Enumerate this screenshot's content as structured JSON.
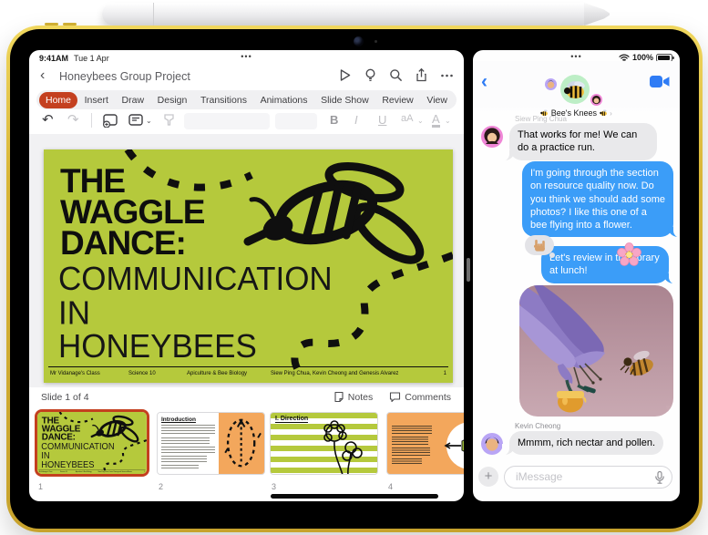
{
  "device": {
    "time": "9:41AM",
    "date": "Tue 1 Apr",
    "battery": "100%",
    "multitask_indicator": "...",
    "status_icons": [
      "wifi-icon",
      "battery-icon"
    ]
  },
  "powerpoint": {
    "document_title": "Honeybees Group Project",
    "tabs": [
      "Home",
      "Insert",
      "Draw",
      "Design",
      "Transitions",
      "Animations",
      "Slide Show",
      "Review",
      "View"
    ],
    "selected_tab": "Home",
    "nav_icons": [
      "back-chevron",
      "play-slideshow",
      "designer-lightbulb",
      "search",
      "share",
      "more-ellipsis"
    ],
    "toolbar_icons": [
      "undo",
      "redo",
      "new-slide",
      "slide-layout",
      "format-painter",
      "bold",
      "italic",
      "underline",
      "text-size",
      "font-color",
      "highlighter"
    ],
    "toolbar": {
      "bold": "B",
      "italic": "I",
      "underline": "U",
      "text_size": "aA",
      "font_color": "A"
    },
    "slide": {
      "title_bold_lines": [
        "THE",
        "WAGGLE",
        "DANCE:"
      ],
      "title_light_lines": [
        "COMMUNICATION",
        "IN",
        "HONEYBEES"
      ],
      "footer": {
        "class_name": "Mr Vidanage's Class",
        "course": "Science 10",
        "subject": "Apiculture & Bee Biology",
        "authors": "Siew Ping Chua, Kevin Cheong and Genesis Alvarez",
        "page_number": "1"
      }
    },
    "status_bar": {
      "slide_counter": "Slide 1 of 4",
      "notes_label": "Notes",
      "comments_label": "Comments"
    },
    "thumbnails": [
      {
        "number": "1",
        "selected": true
      },
      {
        "number": "2",
        "selected": false,
        "heading": "Introduction"
      },
      {
        "number": "3",
        "selected": false,
        "heading": "I. Direction"
      },
      {
        "number": "4",
        "selected": false
      }
    ]
  },
  "messages": {
    "group_name": "Bee's Knees",
    "header_icons": [
      "back-chevron",
      "bee-group-avatar",
      "member-avatar",
      "video-call-icon"
    ],
    "msg1": {
      "sender": "Siew Ping Chua",
      "text": "That works for me! We can do a practice run."
    },
    "msg2": {
      "text": "I'm going through the section on resource quality now. Do you think we should add some photos? I like this one of a bee flying into a flower.",
      "sticker": "cherry-blossom"
    },
    "msg3": {
      "text": "Let's review in the library at lunch!",
      "tapback": "love-you-gesture"
    },
    "photo_message": {
      "content": "bee flying toward purple flower",
      "sticker": "honey-pot"
    },
    "msg4": {
      "sender": "Kevin Cheong",
      "text": "Mmmm, rich nectar and pollen."
    },
    "composer": {
      "placeholder": "iMessage",
      "icons": [
        "plus-icon",
        "microphone-icon"
      ]
    }
  },
  "colors": {
    "powerpoint_accent": "#C4401F",
    "slide_green": "#B5C93C",
    "thumbnail_orange": "#F3A75C",
    "imessage_blue": "#3B9DF8",
    "received_gray": "#E9E9EB",
    "frame_gold": "#D9B637"
  }
}
